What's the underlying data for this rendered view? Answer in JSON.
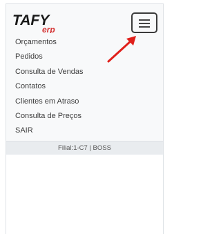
{
  "brand": {
    "logo_main": "TAFY",
    "logo_sub": "erp",
    "logo_main_color": "#1a1a1a",
    "logo_sub_color": "#d32f2f"
  },
  "navbar": {
    "toggler_icon": "hamburger-icon"
  },
  "menu": {
    "items": [
      {
        "label": "Orçamentos"
      },
      {
        "label": "Pedidos"
      },
      {
        "label": "Consulta de Vendas"
      },
      {
        "label": "Contatos"
      },
      {
        "label": "Clientes em Atraso"
      },
      {
        "label": "Consulta de Preços"
      },
      {
        "label": "SAIR"
      }
    ]
  },
  "annotation": {
    "arrow_color": "#e0201b",
    "arrow_icon": "arrow-up-right-icon"
  },
  "footer": {
    "text": "Filial:1-C7 | BOSS"
  }
}
